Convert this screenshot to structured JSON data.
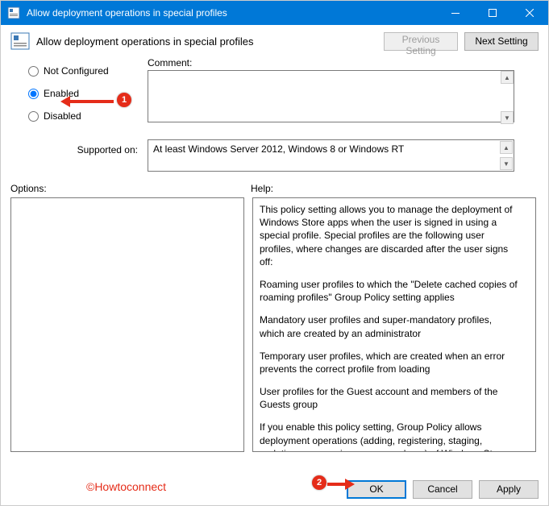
{
  "window": {
    "title": "Allow deployment operations in special profiles"
  },
  "header": {
    "policy_name": "Allow deployment operations in special profiles",
    "prev_btn": "Previous Setting",
    "next_btn": "Next Setting"
  },
  "state": {
    "not_configured": "Not Configured",
    "enabled": "Enabled",
    "disabled": "Disabled",
    "selected": "enabled"
  },
  "labels": {
    "comment": "Comment:",
    "supported": "Supported on:",
    "options": "Options:",
    "help": "Help:"
  },
  "supported_on": "At least Windows Server 2012, Windows 8 or Windows RT",
  "help": {
    "p1": "This policy setting allows you to manage the deployment of Windows Store apps when the user is signed in using a special profile. Special profiles are the following user profiles, where changes are discarded after the user signs off:",
    "p2": "Roaming user profiles to which the \"Delete cached copies of roaming profiles\" Group Policy setting applies",
    "p3": "Mandatory user profiles and super-mandatory profiles, which are created by an administrator",
    "p4": "Temporary user profiles, which are created when an error prevents the correct profile from loading",
    "p5": "User profiles for the Guest account and members of the Guests group",
    "p6": "If you enable this policy setting, Group Policy allows deployment operations (adding, registering, staging, updating, or removing an app package) of Windows Store apps when using a special"
  },
  "footer": {
    "ok": "OK",
    "cancel": "Cancel",
    "apply": "Apply"
  },
  "annotations": {
    "watermark": "©Howtoconnect"
  }
}
